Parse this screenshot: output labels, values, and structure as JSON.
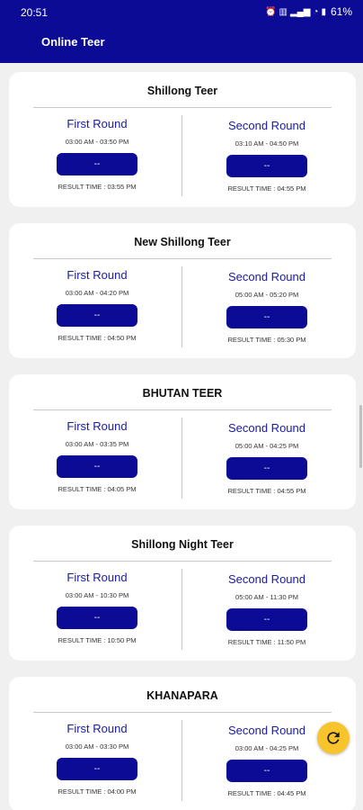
{
  "status_bar": {
    "time": "20:51",
    "icons": [
      "alarm-icon",
      "vibrate-icon",
      "signal-icon",
      "wifi-icon",
      "battery-icon"
    ],
    "battery": "61%"
  },
  "app_bar": {
    "title": "Online Teer"
  },
  "cards": [
    {
      "title": "Shillong Teer",
      "first": {
        "name": "First Round",
        "time": "03:00 AM - 03:50 PM",
        "result": "--",
        "result_time": "RESULT TIME : 03:55 PM"
      },
      "second": {
        "name": "Second Round",
        "time": "03:10 AM - 04:50 PM",
        "result": "--",
        "result_time": "RESULT TIME : 04:55 PM"
      }
    },
    {
      "title": "New Shillong Teer",
      "first": {
        "name": "First Round",
        "time": "03:00 AM - 04:20 PM",
        "result": "--",
        "result_time": "RESULT TIME : 04:50 PM"
      },
      "second": {
        "name": "Second Round",
        "time": "05:00 AM - 05:20 PM",
        "result": "--",
        "result_time": "RESULT TIME : 05:30 PM"
      }
    },
    {
      "title": "BHUTAN TEER",
      "first": {
        "name": "First Round",
        "time": "03:00 AM - 03:35 PM",
        "result": "--",
        "result_time": "RESULT TIME : 04:05 PM"
      },
      "second": {
        "name": "Second Round",
        "time": "05:00 AM - 04:25 PM",
        "result": "--",
        "result_time": "RESULT TIME : 04:55 PM"
      }
    },
    {
      "title": "Shillong Night Teer",
      "first": {
        "name": "First Round",
        "time": "03:00 AM - 10:30 PM",
        "result": "--",
        "result_time": "RESULT TIME : 10:50 PM"
      },
      "second": {
        "name": "Second Round",
        "time": "05:00 AM - 11:30 PM",
        "result": "--",
        "result_time": "RESULT TIME : 11:50 PM"
      }
    },
    {
      "title": "KHANAPARA",
      "first": {
        "name": "First Round",
        "time": "03:00 AM - 03:30 PM",
        "result": "--",
        "result_time": "RESULT TIME : 04:00 PM"
      },
      "second": {
        "name": "Second Round",
        "time": "03:00 AM - 04:25 PM",
        "result": "--",
        "result_time": "RESULT TIME : 04:45 PM"
      }
    }
  ],
  "fab": {
    "icon": "refresh-icon"
  },
  "colors": {
    "primary": "#0b0b96",
    "accent": "#f7c52b",
    "round_text": "#1a1aa8"
  }
}
